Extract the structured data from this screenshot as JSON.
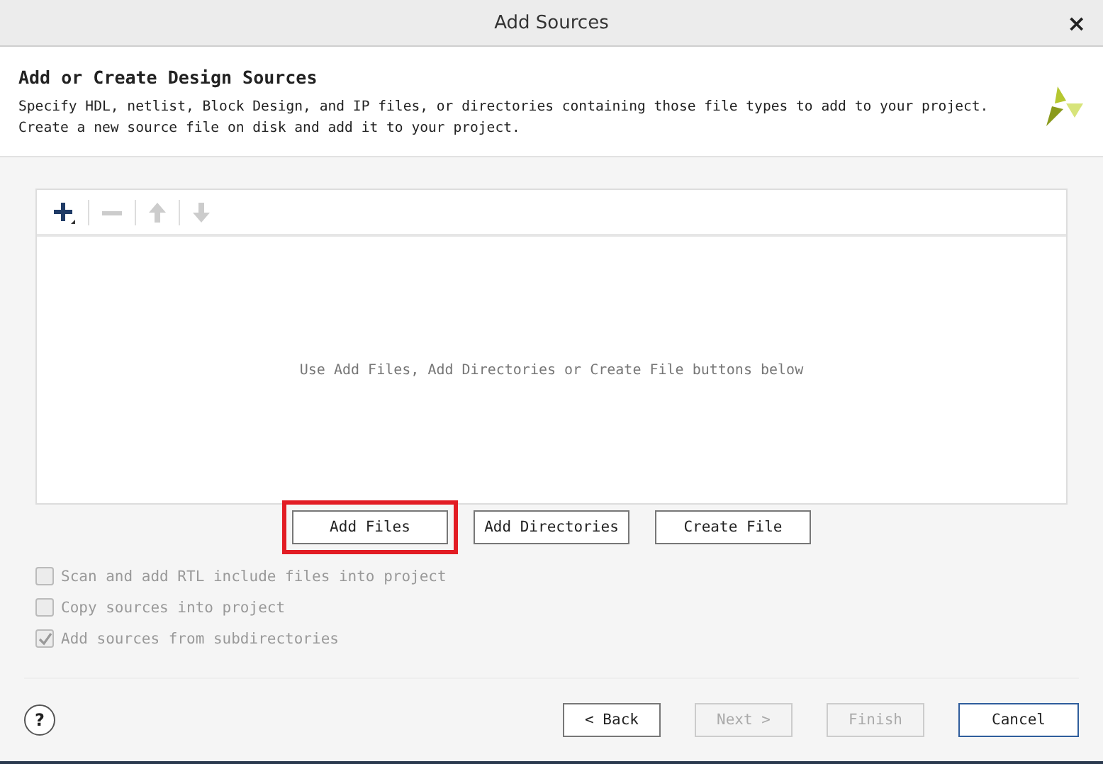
{
  "window": {
    "title": "Add Sources",
    "close": "×"
  },
  "header": {
    "title": "Add or Create Design Sources",
    "description": "Specify HDL, netlist, Block Design, and IP files, or directories containing those file types to add to your project. Create a new source file on disk and add it to your project."
  },
  "toolbar": [
    {
      "kind": "add",
      "disabled": false
    },
    {
      "kind": "remove",
      "disabled": true
    },
    {
      "kind": "up",
      "disabled": true
    },
    {
      "kind": "down",
      "disabled": true
    }
  ],
  "file_list": {
    "empty_message": "Use Add Files, Add Directories or Create File buttons below"
  },
  "add_buttons": [
    {
      "label": "Add Files",
      "highlighted": true
    },
    {
      "label": "Add Directories",
      "highlighted": false
    },
    {
      "label": "Create File",
      "highlighted": false
    }
  ],
  "options": [
    {
      "label": "Scan and add RTL include files into project",
      "checked": false,
      "disabled": true
    },
    {
      "label": "Copy sources into project",
      "checked": false,
      "disabled": true
    },
    {
      "label": "Add sources from subdirectories",
      "checked": true,
      "disabled": true
    }
  ],
  "footer": {
    "help": "?",
    "buttons": [
      {
        "label": "< Back",
        "disabled": false,
        "default": false
      },
      {
        "label": "Next >",
        "disabled": true,
        "default": false
      },
      {
        "label": "Finish",
        "disabled": true,
        "default": false
      },
      {
        "label": "Cancel",
        "disabled": false,
        "default": true
      }
    ]
  }
}
